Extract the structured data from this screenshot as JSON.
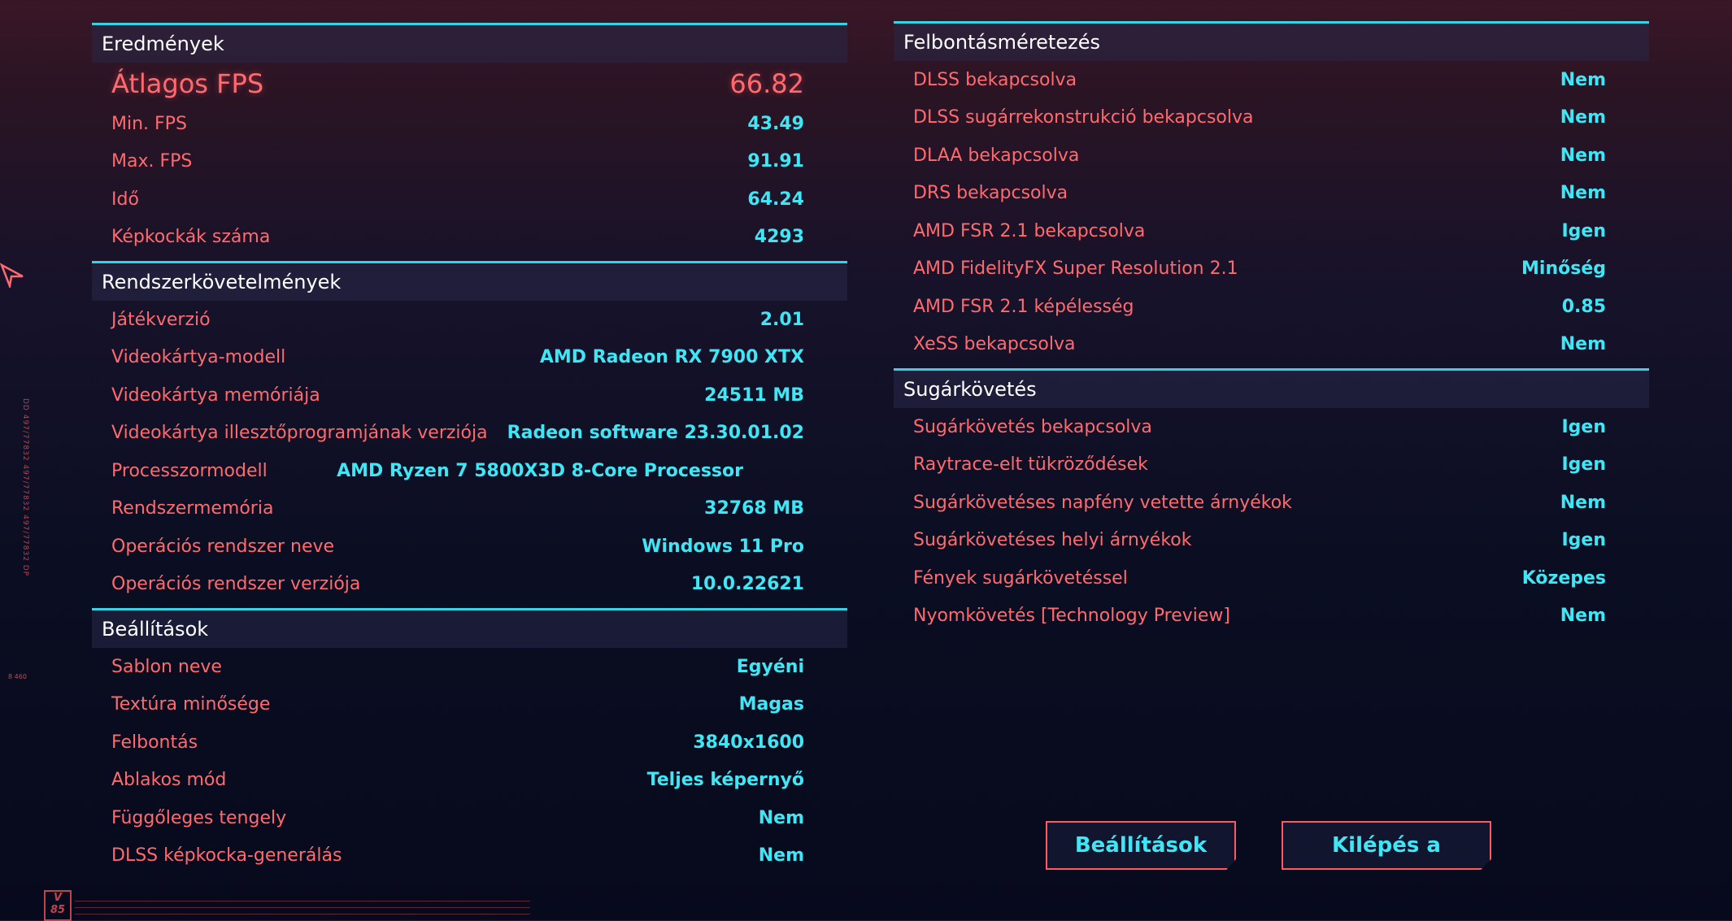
{
  "results": {
    "title": "Eredmények",
    "rows": [
      {
        "label": "Átlagos FPS",
        "value": "66.82"
      },
      {
        "label": "Min. FPS",
        "value": "43.49"
      },
      {
        "label": "Max. FPS",
        "value": "91.91"
      },
      {
        "label": "Idő",
        "value": "64.24"
      },
      {
        "label": "Képkockák száma",
        "value": "4293"
      }
    ]
  },
  "system": {
    "title": "Rendszerkövetelmények",
    "rows": [
      {
        "label": "Játékverzió",
        "value": "2.01"
      },
      {
        "label": "Videokártya-modell",
        "value": "AMD Radeon RX 7900 XTX"
      },
      {
        "label": "Videokártya memóriája",
        "value": "24511 MB"
      },
      {
        "label": "Videokártya illesztőprogramjának verziója",
        "value": "Radeon software 23.30.01.02"
      },
      {
        "label": "Processzormodell",
        "value": "AMD Ryzen 7 5800X3D 8-Core Processor"
      },
      {
        "label": "Rendszermemória",
        "value": "32768 MB"
      },
      {
        "label": "Operációs rendszer neve",
        "value": "Windows 11 Pro"
      },
      {
        "label": "Operációs rendszer verziója",
        "value": "10.0.22621"
      }
    ]
  },
  "settings": {
    "title": "Beállítások",
    "rows": [
      {
        "label": "Sablon neve",
        "value": "Egyéni"
      },
      {
        "label": "Textúra minősége",
        "value": "Magas"
      },
      {
        "label": "Felbontás",
        "value": "3840x1600"
      },
      {
        "label": "Ablakos mód",
        "value": "Teljes képernyő"
      },
      {
        "label": "Függőleges tengely",
        "value": "Nem"
      },
      {
        "label": "DLSS képkocka-generálás",
        "value": "Nem"
      }
    ]
  },
  "scaling": {
    "title": "Felbontásméretezés",
    "rows": [
      {
        "label": "DLSS bekapcsolva",
        "value": "Nem"
      },
      {
        "label": "DLSS sugárrekonstrukció bekapcsolva",
        "value": "Nem"
      },
      {
        "label": "DLAA bekapcsolva",
        "value": "Nem"
      },
      {
        "label": "DRS bekapcsolva",
        "value": "Nem"
      },
      {
        "label": "AMD FSR 2.1 bekapcsolva",
        "value": "Igen"
      },
      {
        "label": "AMD FidelityFX Super Resolution 2.1",
        "value": "Minőség"
      },
      {
        "label": "AMD FSR 2.1 képélesség",
        "value": "0.85"
      },
      {
        "label": "XeSS bekapcsolva",
        "value": "Nem"
      }
    ]
  },
  "raytracing": {
    "title": "Sugárkövetés",
    "rows": [
      {
        "label": "Sugárkövetés bekapcsolva",
        "value": "Igen"
      },
      {
        "label": "Raytrace-elt tükröződések",
        "value": "Igen"
      },
      {
        "label": "Sugárkövetéses napfény vetette árnyékok",
        "value": "Nem"
      },
      {
        "label": "Sugárkövetéses helyi árnyékok",
        "value": "Igen"
      },
      {
        "label": "Fények sugárkövetéssel",
        "value": "Közepes"
      },
      {
        "label": "Nyomkövetés [Technology Preview]",
        "value": "Nem"
      }
    ]
  },
  "buttons": {
    "settings": "Beállítások",
    "exit": "Kilépés a főmenübe"
  },
  "decor": {
    "logo": "V 85",
    "side_code": "DD 497/77832 497/77832 497/77832 DP",
    "side_mark": "8 460",
    "cursor_icon": "arrow-cursor-icon",
    "colors": {
      "accent": "#35d3e6",
      "label": "#ff6a6f",
      "value": "#3fe6f5"
    }
  }
}
